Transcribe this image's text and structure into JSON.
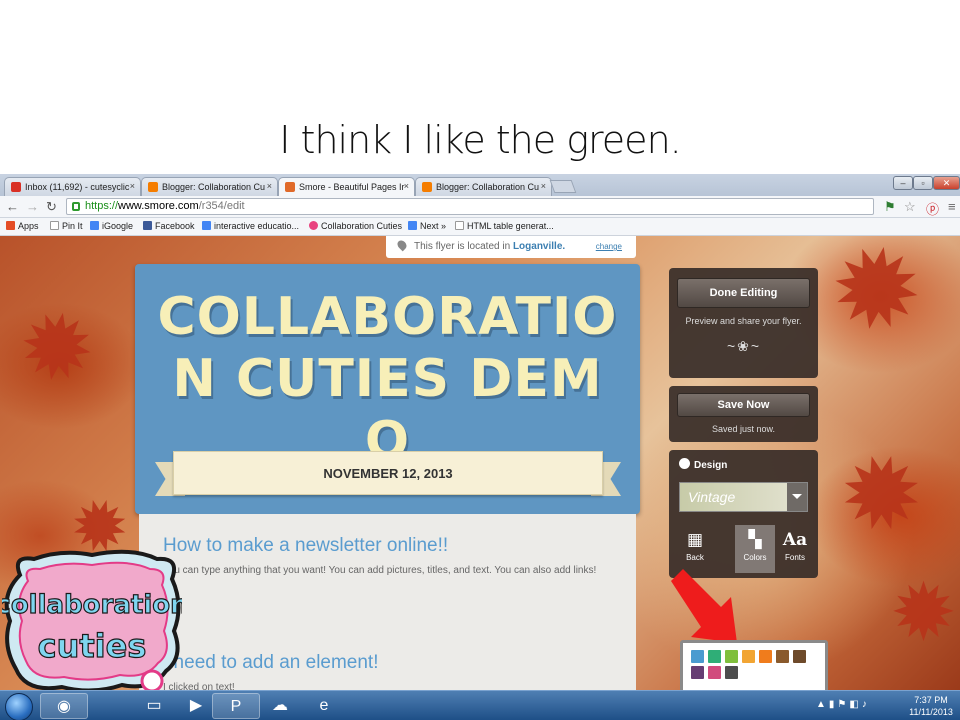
{
  "caption": "I think I like the green.",
  "browser": {
    "tabs": [
      {
        "label": "Inbox (11,692) - cutesyclic",
        "close": "×",
        "active": false,
        "icon_color": "#d93025"
      },
      {
        "label": "Blogger: Collaboration Cu",
        "close": "×",
        "active": false,
        "icon_color": "#f57d00"
      },
      {
        "label": "Smore - Beautiful Pages Ir",
        "close": "×",
        "active": true,
        "icon_color": "#e06a2a"
      },
      {
        "label": "Blogger: Collaboration Cu",
        "close": "×",
        "active": false,
        "icon_color": "#f57d00"
      }
    ],
    "url": {
      "scheme": "https://",
      "domain": "www.smore.com",
      "path": "/r354/edit"
    },
    "bookmarks": [
      {
        "label": "Apps",
        "icon_color": "#e44d26"
      },
      {
        "label": "Pin It",
        "icon_color": "#ffffff"
      },
      {
        "label": "iGoogle",
        "icon_color": "#4285f4"
      },
      {
        "label": "Facebook",
        "icon_color": "#3b5998"
      },
      {
        "label": "interactive educatio...",
        "icon_color": "#4285f4"
      },
      {
        "label": "Collaboration Cuties",
        "icon_color": "#e8427f"
      },
      {
        "label": "Next »",
        "icon_color": "#4285f4"
      },
      {
        "label": "HTML table generat...",
        "icon_color": "#ffffff"
      }
    ]
  },
  "page": {
    "location_prefix": "This flyer is located in",
    "location_value": "Loganville.",
    "location_change": "change",
    "flyer_title": "COLLABORATIO N CUTIES DEMO",
    "flyer_date": "NOVEMBER 12, 2013",
    "section1_title": "How to make a newsletter online!!",
    "section1_text": "You can type anything that you want! You can add pictures, titles, and text. You can also add links!",
    "section2_title": "I need to add an element!",
    "section2_text": "I clicked on text!"
  },
  "panel": {
    "done_editing": "Done Editing",
    "done_sub": "Preview and share your flyer.",
    "ornament": "~❀~",
    "save_now": "Save Now",
    "save_sub": "Saved just now.",
    "design_label": "Design",
    "theme_name": "Vintage",
    "tools": {
      "background": "Back",
      "colors": "Colors",
      "fonts": "Fonts",
      "fonts_glyph": "Aa"
    }
  },
  "palette_colors": [
    "#4a9bd0",
    "#2fae77",
    "#7fbf3c",
    "#f2a533",
    "#f07c1c",
    "#8a5a2c",
    "#6e4a2a",
    "#663d73",
    "#d14b7d",
    "#4d4d4d"
  ],
  "logo": {
    "line1": "collaboration",
    "line2": "cuties"
  },
  "taskbar": {
    "tasks": [
      {
        "name": "chrome",
        "icon": "◉"
      },
      {
        "name": "explorer",
        "icon": "▭"
      },
      {
        "name": "media",
        "icon": "▶"
      },
      {
        "name": "powerpoint",
        "icon": "P"
      },
      {
        "name": "network",
        "icon": "☁"
      },
      {
        "name": "ie",
        "icon": "e"
      }
    ],
    "clock_time": "7:37 PM",
    "clock_date": "11/11/2013"
  },
  "colors": {
    "accent_red": "#ee1c1c",
    "flyer_blue": "#5f96c2",
    "flyer_title": "#f7efb8",
    "link_blue": "#5a9ccf"
  }
}
